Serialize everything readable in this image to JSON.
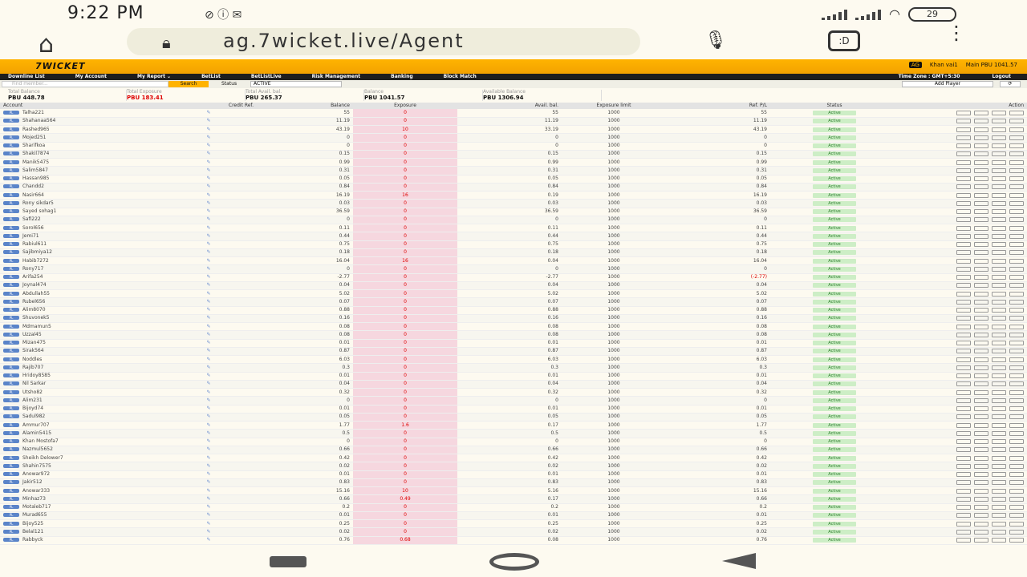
{
  "statusbar": {
    "time": "9:22 PM",
    "battery": "29"
  },
  "browser": {
    "url": "ag.7wicket.live/Agent"
  },
  "brand": {
    "logo": "7WICKET",
    "user_tag": "AG",
    "user_name": "Khan vai1",
    "main_balance": "Main PBU 1041.57"
  },
  "nav": {
    "items": [
      "Downline List",
      "My Account",
      "My Report ⌄",
      "BetList",
      "BetListLive",
      "Risk Management",
      "Banking",
      "Block Match"
    ],
    "timezone": "Time Zone : GMT+5:30",
    "logout": "Logout"
  },
  "filters": {
    "search_placeholder": "Find member...",
    "search_button": "Search",
    "status_label": "Status",
    "status_value": "ACTIVE",
    "add_player": "Add Player"
  },
  "summary": [
    {
      "label": "Total Balance",
      "value": "PBU 448.78",
      "red": false
    },
    {
      "label": "Total Exposure",
      "value": "PBU 183.41",
      "red": true
    },
    {
      "label": "Total Avail. bal.",
      "value": "PBU 265.37",
      "red": false
    },
    {
      "label": "Balance",
      "value": "PBU 1041.57",
      "red": false
    },
    {
      "label": "Available Balance",
      "value": "PBU 1306.94",
      "red": false
    }
  ],
  "table": {
    "headers": [
      "Account",
      "Credit Ref.",
      "Balance",
      "Exposure",
      "Avail. bal.",
      "Exposure limit",
      "Ref. P/L",
      "Status",
      "Action"
    ],
    "badge": "PL",
    "status_text": "Active",
    "rows": [
      [
        "Talha221",
        "55",
        "0",
        "55",
        "1000",
        "55"
      ],
      [
        "Shahanaa564",
        "11.19",
        "0",
        "11.19",
        "1000",
        "11.19"
      ],
      [
        "Rashed965",
        "43.19",
        "10",
        "33.19",
        "1000",
        "43.19"
      ],
      [
        "Mojed251",
        "0",
        "0",
        "0",
        "1000",
        "0"
      ],
      [
        "Sharifkoa",
        "0",
        "0",
        "0",
        "1000",
        "0"
      ],
      [
        "Shakil7874",
        "0.15",
        "0",
        "0.15",
        "1000",
        "0.15"
      ],
      [
        "Manik5475",
        "0.99",
        "0",
        "0.99",
        "1000",
        "0.99"
      ],
      [
        "Salim5847",
        "0.31",
        "0",
        "0.31",
        "1000",
        "0.31"
      ],
      [
        "Hassan985",
        "0.05",
        "0",
        "0.05",
        "1000",
        "0.05"
      ],
      [
        "Chandd2",
        "0.84",
        "0",
        "0.84",
        "1000",
        "0.84"
      ],
      [
        "Nasir664",
        "16.19",
        "16",
        "0.19",
        "1000",
        "16.19"
      ],
      [
        "Rony sikdar5",
        "0.03",
        "0",
        "0.03",
        "1000",
        "0.03"
      ],
      [
        "Sayed sohag1",
        "36.59",
        "0",
        "36.59",
        "1000",
        "36.59"
      ],
      [
        "Safi222",
        "0",
        "0",
        "0",
        "1000",
        "0"
      ],
      [
        "Sorol656",
        "0.11",
        "0",
        "0.11",
        "1000",
        "0.11"
      ],
      [
        "Jemi71",
        "0.44",
        "0",
        "0.44",
        "1000",
        "0.44"
      ],
      [
        "Rabiul611",
        "0.75",
        "0",
        "0.75",
        "1000",
        "0.75"
      ],
      [
        "Sajibmiya12",
        "0.18",
        "0",
        "0.18",
        "1000",
        "0.18"
      ],
      [
        "Habib7272",
        "16.04",
        "16",
        "0.04",
        "1000",
        "16.04"
      ],
      [
        "Rony717",
        "0",
        "0",
        "0",
        "1000",
        "0"
      ],
      [
        "Arifa254",
        "-2.77",
        "0",
        "-2.77",
        "1000",
        "(-2.77)"
      ],
      [
        "Joynal474",
        "0.04",
        "0",
        "0.04",
        "1000",
        "0.04"
      ],
      [
        "Abdullah55",
        "5.02",
        "0",
        "5.02",
        "1000",
        "5.02"
      ],
      [
        "Rubel656",
        "0.07",
        "0",
        "0.07",
        "1000",
        "0.07"
      ],
      [
        "Alim8070",
        "0.88",
        "0",
        "0.88",
        "1000",
        "0.88"
      ],
      [
        "Shuvonek5",
        "0.16",
        "0",
        "0.16",
        "1000",
        "0.16"
      ],
      [
        "Mdmamun5",
        "0.08",
        "0",
        "0.08",
        "1000",
        "0.08"
      ],
      [
        "Uzzal45",
        "0.08",
        "0",
        "0.08",
        "1000",
        "0.08"
      ],
      [
        "Mizan475",
        "0.01",
        "0",
        "0.01",
        "1000",
        "0.01"
      ],
      [
        "Sirak564",
        "0.87",
        "0",
        "0.87",
        "1000",
        "0.87"
      ],
      [
        "Noddles",
        "6.03",
        "0",
        "6.03",
        "1000",
        "6.03"
      ],
      [
        "Rajib707",
        "0.3",
        "0",
        "0.3",
        "1000",
        "0.3"
      ],
      [
        "Hridoy8585",
        "0.01",
        "0",
        "0.01",
        "1000",
        "0.01"
      ],
      [
        "Nil Sarkar",
        "0.04",
        "0",
        "0.04",
        "1000",
        "0.04"
      ],
      [
        "Utsho82",
        "0.32",
        "0",
        "0.32",
        "1000",
        "0.32"
      ],
      [
        "Alim231",
        "0",
        "0",
        "0",
        "1000",
        "0"
      ],
      [
        "Bijoyd74",
        "0.01",
        "0",
        "0.01",
        "1000",
        "0.01"
      ],
      [
        "Sadul982",
        "0.05",
        "0",
        "0.05",
        "1000",
        "0.05"
      ],
      [
        "Ammur707",
        "1.77",
        "1.6",
        "0.17",
        "1000",
        "1.77"
      ],
      [
        "Alamin5415",
        "0.5",
        "0",
        "0.5",
        "1000",
        "0.5"
      ],
      [
        "Khan Mostofa7",
        "0",
        "0",
        "0",
        "1000",
        "0"
      ],
      [
        "Nazmul5652",
        "0.66",
        "0",
        "0.66",
        "1000",
        "0.66"
      ],
      [
        "Sheikh Delower7",
        "0.42",
        "0",
        "0.42",
        "1000",
        "0.42"
      ],
      [
        "Shahin7575",
        "0.02",
        "0",
        "0.02",
        "1000",
        "0.02"
      ],
      [
        "Anowar972",
        "0.01",
        "0",
        "0.01",
        "1000",
        "0.01"
      ],
      [
        "Jakir512",
        "0.83",
        "0",
        "0.83",
        "1000",
        "0.83"
      ],
      [
        "Anowar333",
        "15.16",
        "10",
        "5.16",
        "1000",
        "15.16"
      ],
      [
        "Minhaz73",
        "0.66",
        "0.49",
        "0.17",
        "1000",
        "0.66"
      ],
      [
        "Motaleb717",
        "0.2",
        "0",
        "0.2",
        "1000",
        "0.2"
      ],
      [
        "Murad655",
        "0.01",
        "0",
        "0.01",
        "1000",
        "0.01"
      ],
      [
        "Bijoy525",
        "0.25",
        "0",
        "0.25",
        "1000",
        "0.25"
      ],
      [
        "Belal121",
        "0.02",
        "0",
        "0.02",
        "1000",
        "0.02"
      ],
      [
        "Rabbyck",
        "0.76",
        "0.68",
        "0.08",
        "1000",
        "0.76"
      ]
    ]
  }
}
